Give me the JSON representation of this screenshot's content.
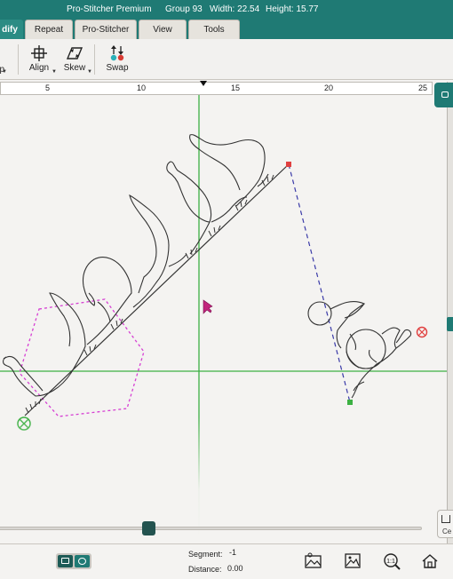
{
  "titlebar": {
    "app": "Pro-Stitcher Premium",
    "group": "Group 93",
    "width": "Width: 22.54",
    "height": "Height: 15.77"
  },
  "tabs": [
    {
      "label": "dify",
      "active": true
    },
    {
      "label": "Repeat",
      "active": false
    },
    {
      "label": "Pro-Stitcher",
      "active": false
    },
    {
      "label": "View",
      "active": false
    },
    {
      "label": "Tools",
      "active": false
    }
  ],
  "toolbar": {
    "partial_label": "p",
    "align_label": "Align",
    "skew_label": "Skew",
    "swap_label": "Swap"
  },
  "ruler": {
    "labels": [
      "5",
      "10",
      "15",
      "20",
      "25"
    ]
  },
  "side": {
    "center_label": "Ce"
  },
  "status": {
    "segment_label": "Segment:",
    "segment_value": "-1",
    "distance_label": "Distance:",
    "distance_value": "0.00"
  },
  "colors": {
    "accent": "#1f7a74",
    "crosshair": "#3cb043",
    "boundary": "#d63fd3",
    "guide_line": "#3a3aa8",
    "stitch": "#333333"
  },
  "icons": [
    "align-icon",
    "skew-icon",
    "swap-icon",
    "cursor-icon",
    "start-point-icon",
    "end-point-icon",
    "grid-view-icon",
    "circle-view-icon",
    "design-image-icon",
    "picture-icon",
    "zoom-icon",
    "home-icon",
    "center-icon"
  ]
}
